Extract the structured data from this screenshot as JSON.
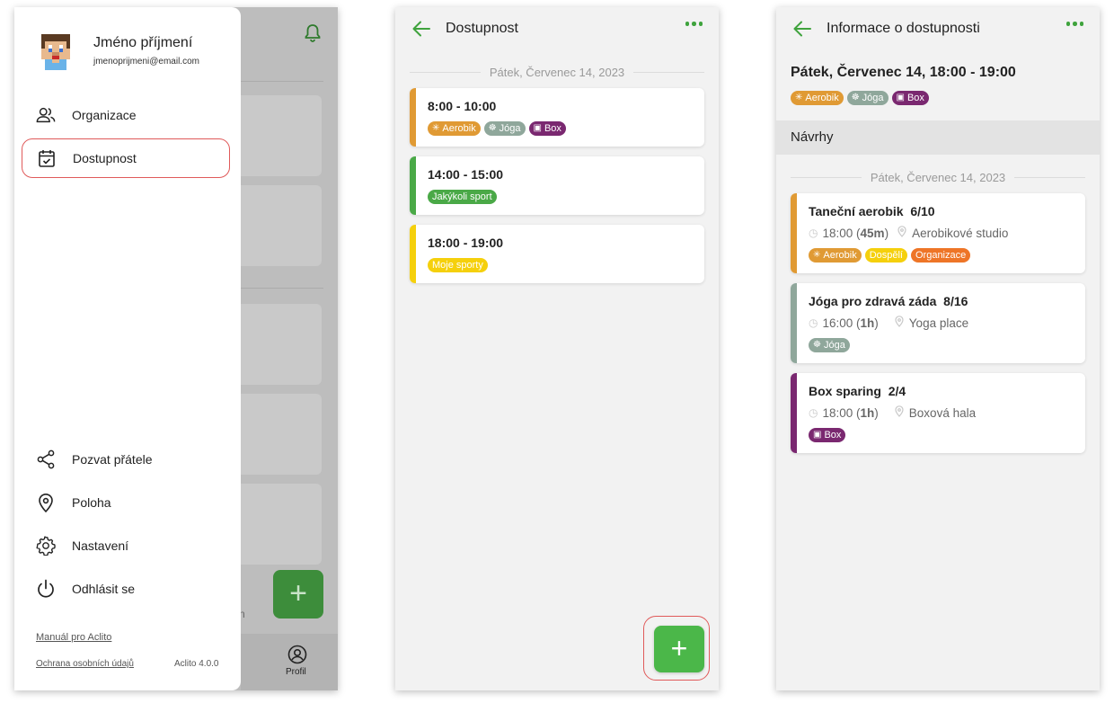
{
  "colors": {
    "aerobik": "#e09a34",
    "joga": "#8fa79b",
    "box": "#7a2870",
    "jakykoli": "#4aa947",
    "moje": "#f5d00c",
    "dospeli": "#f5d00c",
    "organizace": "#ee7527",
    "accent": "#3fa33d",
    "highlight": "#e05a5a"
  },
  "drawer": {
    "user_name": "Jméno příjmení",
    "user_email": "jmenoprijmeni@email.com",
    "menu_top": [
      {
        "label": "Organizace",
        "icon": "people-icon"
      },
      {
        "label": "Dostupnost",
        "icon": "calendar-check-icon"
      }
    ],
    "menu_bottom": [
      {
        "label": "Pozvat přátele",
        "icon": "share-icon"
      },
      {
        "label": "Poloha",
        "icon": "location-pin-icon"
      },
      {
        "label": "Nastavení",
        "icon": "gear-icon"
      },
      {
        "label": "Odhlásit se",
        "icon": "power-icon"
      }
    ],
    "manual_link": "Manuál pro Aclito",
    "privacy_link": "Ochrana osobních údajů",
    "version": "Aclito 4.0.0",
    "background_nav_label": "Profil",
    "background_partial_text": "n",
    "background_fab": "+"
  },
  "availability": {
    "title": "Dostupnost",
    "date": "Pátek, Červenec 14, 2023",
    "fab": "+",
    "slots": [
      {
        "time": "8:00 - 10:00",
        "tags": [
          {
            "label": "Aerobik",
            "icon": "aerobic-icon",
            "color": "aerobik"
          },
          {
            "label": "Jóga",
            "icon": "yoga-icon",
            "color": "joga"
          },
          {
            "label": "Box",
            "icon": "box-icon",
            "color": "box"
          }
        ]
      },
      {
        "time": "14:00 - 15:00",
        "tags": [
          {
            "label": "Jakýkoli sport",
            "color": "jakykoli"
          }
        ]
      },
      {
        "time": "18:00 - 19:00",
        "tags": [
          {
            "label": "Moje sporty",
            "color": "moje"
          }
        ]
      }
    ]
  },
  "info": {
    "title": "Informace o dostupnosti",
    "slot_title": "Pátek, Červenec 14, 18:00 - 19:00",
    "tags": [
      {
        "label": "Aerobik",
        "icon": "aerobic-icon",
        "color": "aerobik"
      },
      {
        "label": "Jóga",
        "icon": "yoga-icon",
        "color": "joga"
      },
      {
        "label": "Box",
        "icon": "box-icon",
        "color": "box"
      }
    ],
    "section_title": "Návrhy",
    "date": "Pátek, Červenec 14, 2023",
    "suggestions": [
      {
        "name": "Taneční aerobik",
        "capacity": "6/10",
        "time": "18:00",
        "duration": "45m",
        "place": "Aerobikové studio",
        "color": "aerobik",
        "tags": [
          {
            "label": "Aerobik",
            "icon": "aerobic-icon",
            "color": "aerobik"
          },
          {
            "label": "Dospělí",
            "color": "dospeli"
          },
          {
            "label": "Organizace",
            "color": "organizace"
          }
        ]
      },
      {
        "name": "Jóga pro zdravá záda",
        "capacity": "8/16",
        "time": "16:00",
        "duration": "1h",
        "place": "Yoga place",
        "color": "joga",
        "tags": [
          {
            "label": "Jóga",
            "icon": "yoga-icon",
            "color": "joga"
          }
        ]
      },
      {
        "name": "Box sparing",
        "capacity": "2/4",
        "time": "18:00",
        "duration": "1h",
        "place": "Boxová hala",
        "color": "box",
        "tags": [
          {
            "label": "Box",
            "icon": "box-icon",
            "color": "box"
          }
        ]
      }
    ]
  }
}
